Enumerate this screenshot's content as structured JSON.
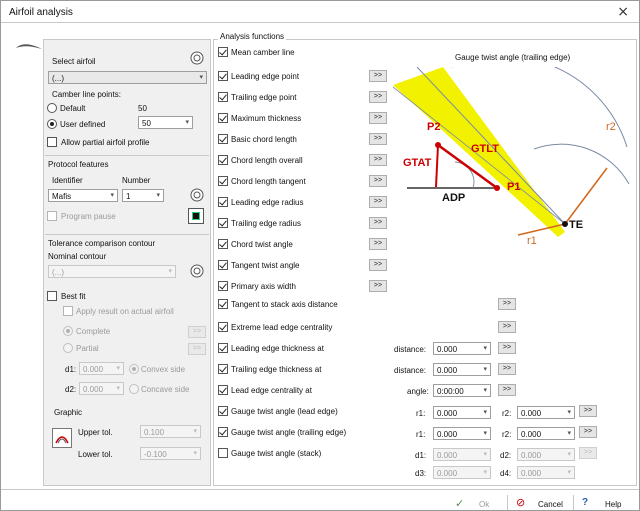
{
  "window": {
    "title": "Airfoil analysis",
    "close": "×"
  },
  "left": {
    "select_airfoil": "Select airfoil",
    "airfoil_value": "(...)",
    "camber_title": "Camber line points:",
    "camber_default": "Default",
    "camber_default_val": "50",
    "camber_user": "User defined",
    "camber_user_val": "50",
    "allow_partial": "Allow partial airfoil profile",
    "protocol_title": "Protocol features",
    "identifier_label": "Identifier",
    "number_label": "Number",
    "identifier_val": "Mafis",
    "number_val": "1",
    "program_pause": "Program pause",
    "tol_title": "Tolerance  comparison contour",
    "nominal_label": "Nominal contour",
    "nominal_val": "(...)",
    "best_fit": "Best fit",
    "apply_result": "Apply result on actual airfoil",
    "complete": "Complete",
    "partial": "Partial",
    "d1": "d1:",
    "d2": "d2:",
    "d_val": "0.000",
    "convex": "Convex side",
    "concave": "Concave side",
    "graphic": "Graphic",
    "upper": "Upper tol.",
    "lower": "Lower tol.",
    "upper_val": "0.100",
    "lower_val": "-0.100"
  },
  "functions": {
    "title": "Analysis functions",
    "items": [
      {
        "label": "Mean camber line",
        "checked": true,
        "btn": false
      },
      {
        "label": "Leading edge point",
        "checked": true,
        "btn": true
      },
      {
        "label": "Trailing edge point",
        "checked": true,
        "btn": true
      },
      {
        "label": "Maximum thickness",
        "checked": true,
        "btn": true
      },
      {
        "label": "Basic chord length",
        "checked": true,
        "btn": true
      },
      {
        "label": "Chord length overall",
        "checked": true,
        "btn": true
      },
      {
        "label": "Chord length tangent",
        "checked": true,
        "btn": true
      },
      {
        "label": "Leading edge radius",
        "checked": true,
        "btn": true
      },
      {
        "label": "Trailing edge radius",
        "checked": true,
        "btn": true
      },
      {
        "label": "Chord twist angle",
        "checked": true,
        "btn": true
      },
      {
        "label": "Tangent twist angle",
        "checked": true,
        "btn": true
      },
      {
        "label": "Primary axis width",
        "checked": true,
        "btn": true
      },
      {
        "label": "Tangent to stack axis distance",
        "checked": true,
        "btn": true
      },
      {
        "label": "Extreme lead edge centrality",
        "checked": true,
        "btn": true
      },
      {
        "label": "Leading edge thickness at",
        "checked": true,
        "btn": true
      },
      {
        "label": "Trailing edge thickness at",
        "checked": true,
        "btn": true
      },
      {
        "label": "Lead edge centrality at",
        "checked": true,
        "btn": true
      },
      {
        "label": "Gauge twist angle (lead edge)",
        "checked": true,
        "btn": true
      },
      {
        "label": "Gauge twist angle (trailing edge)",
        "checked": true,
        "btn": true
      },
      {
        "label": "Gauge twist angle (stack)",
        "checked": false,
        "btn": true
      }
    ],
    "btn_label": ">>",
    "distance": "distance:",
    "angle": "angle:",
    "val0": "0.000",
    "angle_val": "0:00:00",
    "r1": "r1:",
    "r2": "r2:",
    "d1": "d1:",
    "d2": "d2:",
    "d3": "d3:",
    "d4": "d4:"
  },
  "diagram": {
    "title": "Gauge twist angle (trailing edge)",
    "p1": "P1",
    "p2": "P2",
    "gtlt": "GTLT",
    "gtat": "GTAT",
    "adp": "ADP",
    "te": "TE",
    "r1": "r1",
    "r2": "r2",
    "colors": {
      "red": "#cc0000",
      "yellow": "#f2f200",
      "orange": "#d2691e"
    }
  },
  "footer": {
    "ok": "Ok",
    "cancel": "Cancel",
    "help": "Help",
    "check": "✓",
    "cancel_icon": "⊘",
    "help_icon": "?"
  }
}
